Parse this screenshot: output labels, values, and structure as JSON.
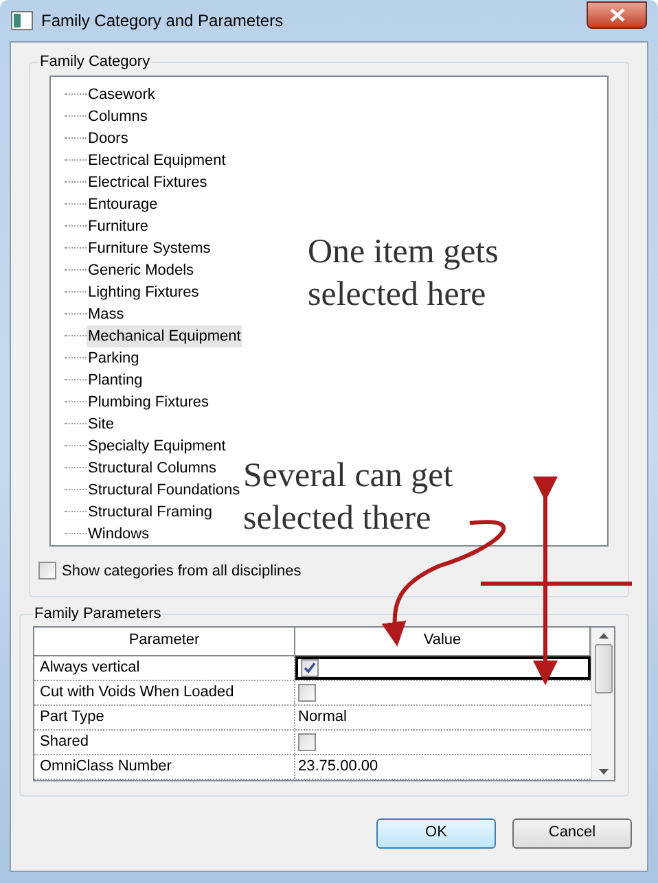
{
  "window": {
    "title": "Family Category and Parameters"
  },
  "family_category": {
    "label": "Family Category",
    "items": [
      {
        "label": "Casework",
        "selected": false
      },
      {
        "label": "Columns",
        "selected": false
      },
      {
        "label": "Doors",
        "selected": false
      },
      {
        "label": "Electrical Equipment",
        "selected": false
      },
      {
        "label": "Electrical Fixtures",
        "selected": false
      },
      {
        "label": "Entourage",
        "selected": false
      },
      {
        "label": "Furniture",
        "selected": false
      },
      {
        "label": "Furniture Systems",
        "selected": false
      },
      {
        "label": "Generic Models",
        "selected": false
      },
      {
        "label": "Lighting Fixtures",
        "selected": false
      },
      {
        "label": "Mass",
        "selected": false
      },
      {
        "label": "Mechanical Equipment",
        "selected": true
      },
      {
        "label": "Parking",
        "selected": false
      },
      {
        "label": "Planting",
        "selected": false
      },
      {
        "label": "Plumbing Fixtures",
        "selected": false
      },
      {
        "label": "Site",
        "selected": false
      },
      {
        "label": "Specialty Equipment",
        "selected": false
      },
      {
        "label": "Structural Columns",
        "selected": false
      },
      {
        "label": "Structural Foundations",
        "selected": false
      },
      {
        "label": "Structural Framing",
        "selected": false
      },
      {
        "label": "Windows",
        "selected": false
      }
    ],
    "show_all": {
      "label": "Show categories from all disciplines",
      "checked": false
    }
  },
  "family_parameters": {
    "label": "Family Parameters",
    "columns": [
      "Parameter",
      "Value"
    ],
    "rows": [
      {
        "parameter": "Always vertical",
        "kind": "checkbox",
        "checked": true,
        "selected": true
      },
      {
        "parameter": "Cut with Voids When Loaded",
        "kind": "checkbox",
        "checked": false,
        "selected": false
      },
      {
        "parameter": "Part Type",
        "kind": "text",
        "value": "Normal",
        "selected": false
      },
      {
        "parameter": "Shared",
        "kind": "checkbox",
        "checked": false,
        "selected": false
      },
      {
        "parameter": "OmniClass Number",
        "kind": "text",
        "value": "23.75.00.00",
        "selected": false
      }
    ]
  },
  "buttons": [
    {
      "label": "OK",
      "default": true
    },
    {
      "label": "Cancel",
      "default": false
    }
  ],
  "annotations": [
    "One item gets selected here",
    "Several can get selected there"
  ]
}
